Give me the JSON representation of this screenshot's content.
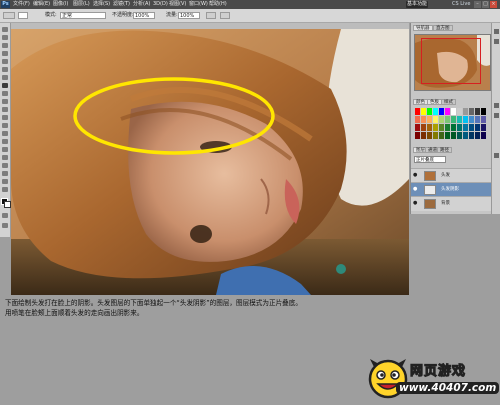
{
  "app": {
    "logo_text": "Ps",
    "menu": [
      "文件(F)",
      "编辑(E)",
      "图像(I)",
      "图层(L)",
      "选择(S)",
      "滤镜(T)",
      "分析(A)",
      "3D(D)",
      "视图(V)",
      "窗口(W)",
      "帮助(H)"
    ],
    "workspace_label": "基本功能",
    "cs_live_label": "CS Live"
  },
  "options": {
    "mode_label": "模式:",
    "mode_value": "正常",
    "opacity_label": "不透明度:",
    "opacity_value": "100%",
    "flow_label": "流量:",
    "flow_value": "100%"
  },
  "panels": {
    "navigator_tabs": [
      "导航器",
      "直方图"
    ],
    "swatches_tabs": [
      "颜色",
      "色板",
      "样式"
    ],
    "layers_tabs": [
      "图层",
      "通道",
      "路径"
    ],
    "blend_mode": "正片叠底",
    "layers": [
      {
        "name": "头发",
        "selected": false
      },
      {
        "name": "头发阴影",
        "selected": true
      },
      {
        "name": "背景",
        "selected": false
      }
    ]
  },
  "caption": {
    "line1": "下面绘制头发打在脸上的阴影。头发图层的下面单独起一个“头发阴影”的图层，图层模式为正片叠底。",
    "line2": "用喷笔在脸颊上面顺着头发的走向画出阴影来。"
  },
  "brand": {
    "name": "网页游戏",
    "url": "www.40407.com"
  },
  "colors": {
    "highlight_ellipse": "#ffe600",
    "selected_layer": "#6d8fb8"
  }
}
